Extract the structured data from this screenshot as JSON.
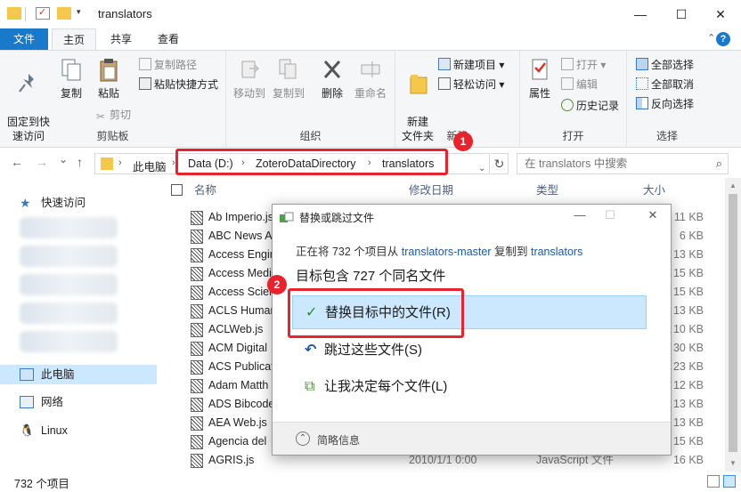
{
  "window": {
    "title": "translators",
    "controls": {
      "minimize": "—",
      "maximize": "☐",
      "close": "✕"
    }
  },
  "quick_access_dropdown": "▾",
  "ribbon_tabs": {
    "file": "文件",
    "home": "主页",
    "share": "共享",
    "view": "查看"
  },
  "ribbon_extra": {
    "collapse": "⌃",
    "help": "?"
  },
  "ribbon": {
    "clipboard": {
      "label": "剪贴板",
      "pin": "固定到快\n速访问",
      "copy": "复制",
      "paste": "粘贴",
      "copy_path": "复制路径",
      "paste_shortcut": "粘贴快捷方式",
      "cut": "剪切"
    },
    "organize": {
      "label": "组织",
      "move_to": "移动到",
      "copy_to": "复制到",
      "delete": "删除",
      "rename": "重命名"
    },
    "new": {
      "label": "新建",
      "new_folder": "新建\n文件夹",
      "new_item": "新建项目",
      "easy_access": "轻松访问"
    },
    "open": {
      "label": "打开",
      "properties": "属性",
      "open": "打开",
      "edit": "编辑",
      "history": "历史记录"
    },
    "select": {
      "label": "选择",
      "select_all": "全部选择",
      "select_none": "全部取消",
      "invert": "反向选择"
    }
  },
  "address": {
    "nav": {
      "back": "←",
      "forward": "→",
      "history": "⌄",
      "up": "↑"
    },
    "crumbs": [
      "此电脑",
      "Data (D:)",
      "ZoteroDataDirectory",
      "translators"
    ],
    "separator": "›",
    "dropdown": "⌄",
    "refresh": "↻",
    "search_placeholder": "在 translators 中搜索"
  },
  "badges": {
    "one": "1",
    "two": "2"
  },
  "nav_pane": {
    "quick_access": "快速访问",
    "this_pc": "此电脑",
    "network": "网络",
    "linux": "Linux"
  },
  "columns": {
    "name": "名称",
    "date": "修改日期",
    "type": "类型",
    "size": "大小"
  },
  "files": [
    {
      "name": "Ab Imperio.js",
      "date": "",
      "type": "",
      "size": "11 KB"
    },
    {
      "name": "ABC News Au",
      "date": "",
      "type": "",
      "size": "6 KB"
    },
    {
      "name": "Access Engin",
      "date": "",
      "type": "",
      "size": "13 KB"
    },
    {
      "name": "Access Medi",
      "date": "",
      "type": "",
      "size": "15 KB"
    },
    {
      "name": "Access Scien",
      "date": "",
      "type": "",
      "size": "15 KB"
    },
    {
      "name": "ACLS Human",
      "date": "",
      "type": "",
      "size": "13 KB"
    },
    {
      "name": "ACLWeb.js",
      "date": "",
      "type": "",
      "size": "10 KB"
    },
    {
      "name": "ACM Digital",
      "date": "",
      "type": "",
      "size": "30 KB"
    },
    {
      "name": "ACS Publicat",
      "date": "",
      "type": "",
      "size": "23 KB"
    },
    {
      "name": "Adam Matth",
      "date": "",
      "type": "",
      "size": "12 KB"
    },
    {
      "name": "ADS Bibcode",
      "date": "",
      "type": "",
      "size": "13 KB"
    },
    {
      "name": "AEA Web.js",
      "date": "",
      "type": "",
      "size": "13 KB"
    },
    {
      "name": "Agencia del",
      "date": "",
      "type": "",
      "size": "15 KB"
    },
    {
      "name": "AGRIS.js",
      "date": "2010/1/1 0:00",
      "type": "JavaScript 文件",
      "size": "16 KB"
    }
  ],
  "status": {
    "count": "732 个项目"
  },
  "dialog": {
    "title": "替换或跳过文件",
    "minimize": "—",
    "maximize": "☐",
    "close": "✕",
    "line1_pre": "正在将 732 个项目从 ",
    "line1_src": "translators-master",
    "line1_mid": " 复制到 ",
    "line1_dst": "translators",
    "line2": "目标包含 727 个同名文件",
    "options": {
      "replace": "替换目标中的文件(R)",
      "skip": "跳过这些文件(S)",
      "decide": "让我决定每个文件(L)"
    },
    "option_icons": {
      "replace": "✓",
      "skip": "↶",
      "decide": "⧉"
    },
    "less_info": "简略信息",
    "less_info_icon": "⌃"
  },
  "colors": {
    "accent": "#1979ca",
    "highlight": "#e8232d",
    "selection": "#cce8ff"
  }
}
